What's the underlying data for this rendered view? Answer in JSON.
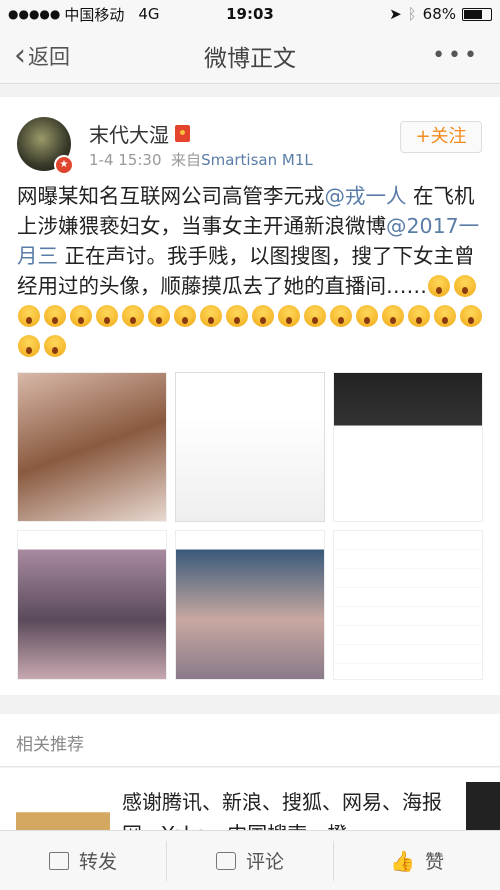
{
  "status_bar": {
    "signal": "●●●●●",
    "carrier": "中国移动",
    "network": "4G",
    "time": "19:03",
    "battery": "68%",
    "battery_level": 0.68
  },
  "nav": {
    "back_label": "返回",
    "title": "微博正文",
    "more": "•••"
  },
  "post": {
    "username": "末代大湿",
    "time": "1-4 15:30",
    "source_prefix": "来自",
    "source": "Smartisan M1L",
    "follow_label": "+关注",
    "text_1": "网曝某知名互联网公司高管李元戎",
    "mention_1": "@戎一人",
    "text_2": " 在飞机上涉嫌猥亵妇女，当事女主开通新浪微博",
    "mention_2": "@2017一月三",
    "text_3": " 正在声讨。我手贱，以图搜图，搜了下女主曾经用过的头像，顺藤摸瓜去了她的直播间……",
    "emoji": "surprised-face-emoji",
    "emoji_count": 22,
    "image_count": 6
  },
  "related": {
    "title": "相关推荐",
    "item_text": "感谢腾讯、新浪、搜狐、网易、海报网、Yoka、中国搜索、橙"
  },
  "toolbar": {
    "repost": "转发",
    "comment": "评论",
    "like": "赞"
  },
  "colors": {
    "link": "#5a7da8",
    "follow": "#f28c1e",
    "badge": "#e0452d"
  }
}
